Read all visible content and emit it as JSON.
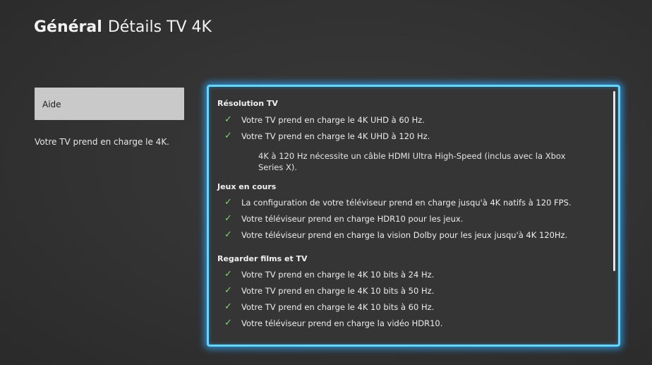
{
  "header": {
    "section": "Général",
    "title": "Détails TV 4K"
  },
  "left_pane": {
    "button_label": "Aide",
    "description": "Votre TV prend en charge le 4K."
  },
  "details": {
    "groups": [
      {
        "title": "Résolution TV",
        "items": [
          "Votre TV prend en charge le 4K UHD à 60 Hz.",
          "Votre TV prend en charge le 4K UHD à 120 Hz."
        ],
        "note": "4K à 120 Hz nécessite un câble HDMI Ultra High-Speed (inclus avec la Xbox Series X)."
      },
      {
        "title": "Jeux en cours",
        "items": [
          "La configuration de votre téléviseur prend en charge jusqu'à 4K natifs à 120 FPS.",
          "Votre téléviseur prend en charge HDR10 pour les jeux.",
          "Votre téléviseur prend en charge la vision Dolby pour les jeux jusqu'à 4K 120Hz."
        ]
      },
      {
        "title": "Regarder films et TV",
        "items": [
          "Votre TV prend en charge le 4K 10 bits à 24 Hz.",
          "Votre TV prend en charge le 4K 10 bits à 50 Hz.",
          "Votre TV prend en charge le 4K 10 bits à 60 Hz.",
          "Votre téléviseur prend en charge la vidéo HDR10."
        ]
      }
    ]
  },
  "colors": {
    "accent_glow": "#5fd7ff",
    "check": "#7bd96a",
    "button_bg": "#c9c9c9"
  },
  "icons": {
    "check": "check-icon"
  }
}
